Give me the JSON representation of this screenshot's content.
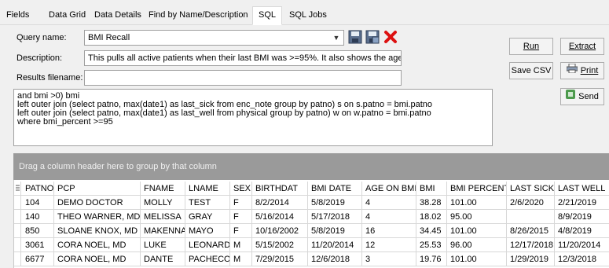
{
  "tabs": [
    {
      "label": "Fields",
      "active": false
    },
    {
      "label": "Data Grid",
      "active": false
    },
    {
      "label": "Data Details",
      "active": false
    },
    {
      "label": "Find by Name/Description",
      "active": false
    },
    {
      "label": "SQL",
      "active": true
    },
    {
      "label": "SQL Jobs",
      "active": false
    }
  ],
  "form": {
    "query_name_label": "Query name:",
    "query_name_value": "BMI Recall",
    "description_label": "Description:",
    "description_value": "This pulls all active patients when their last BMI was >=95%. It also shows the age",
    "results_label": "Results filename:",
    "results_value": ""
  },
  "buttons": {
    "run": "Run",
    "extract": "Extract",
    "save_csv": "Save CSV",
    "print": "Print",
    "send": "Send"
  },
  "sql_text": "and bmi >0) bmi\nleft outer join (select patno, max(date1) as last_sick from enc_note group by patno) s on s.patno = bmi.patno\nleft outer join (select patno, max(date1) as last_well from physical group by patno) w on w.patno = bmi.patno\nwhere bmi_percent >=95",
  "group_bar_text": "Drag a column header here to group by that column",
  "grid": {
    "columns": [
      "PATNO",
      "PCP",
      "FNAME",
      "LNAME",
      "SEX",
      "BIRTHDAT",
      "BMI DATE",
      "AGE ON BMI",
      "BMI",
      "BMI PERCENT",
      "LAST SICK",
      "LAST WELL"
    ],
    "rows": [
      [
        "104",
        "DEMO DOCTOR",
        "MOLLY",
        "TEST",
        "F",
        "8/2/2014",
        "5/8/2019",
        "4",
        "38.28",
        "101.00",
        "2/6/2020",
        "2/21/2019"
      ],
      [
        "140",
        "THEO WARNER, MD",
        "MELISSA",
        "GRAY",
        "F",
        "5/16/2014",
        "5/17/2018",
        "4",
        "18.02",
        "95.00",
        "",
        "8/9/2019"
      ],
      [
        "850",
        "SLOANE KNOX, MD",
        "MAKENNA",
        "MAYO",
        "F",
        "10/16/2002",
        "5/8/2019",
        "16",
        "34.45",
        "101.00",
        "8/26/2015",
        "4/8/2019"
      ],
      [
        "3061",
        "CORA NOEL, MD",
        "LUKE",
        "LEONARD",
        "M",
        "5/15/2002",
        "11/20/2014",
        "12",
        "25.53",
        "96.00",
        "12/17/2018",
        "11/20/2014"
      ],
      [
        "6677",
        "CORA NOEL, MD",
        "DANTE",
        "PACHECO",
        "M",
        "7/29/2015",
        "12/6/2018",
        "3",
        "19.76",
        "101.00",
        "1/29/2019",
        "12/3/2018"
      ]
    ]
  }
}
